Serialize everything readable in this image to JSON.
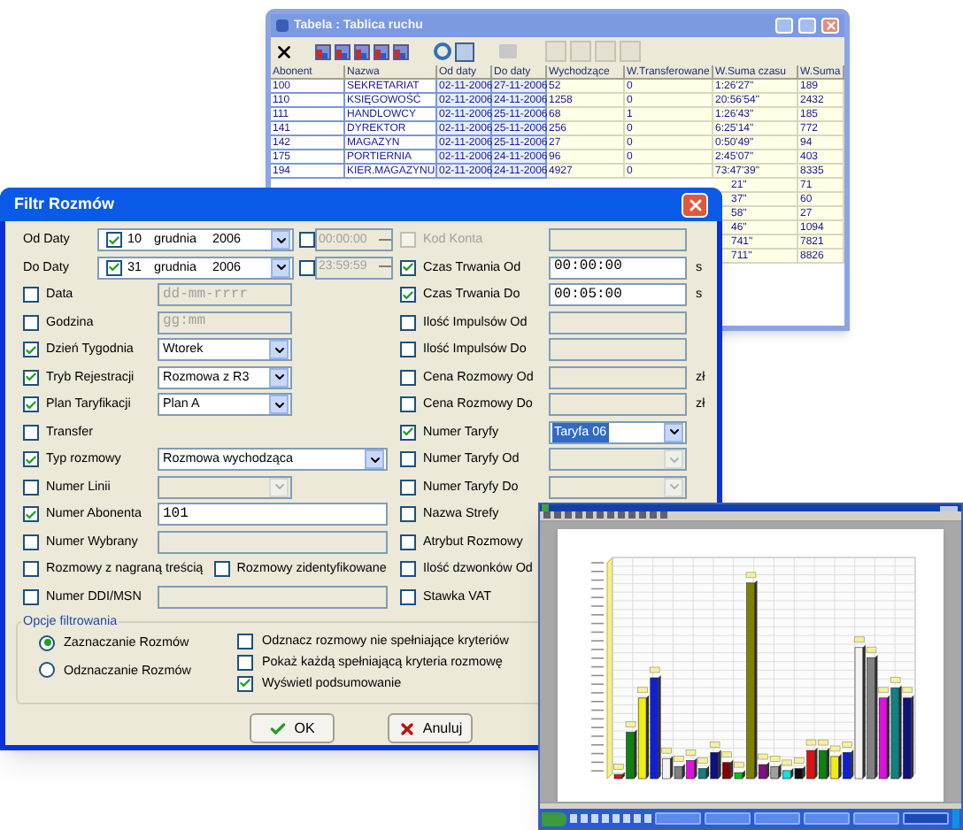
{
  "table_window": {
    "title": "Tabela : Tablica ruchu",
    "columns": [
      "Abonent",
      "Nazwa",
      "Od daty",
      "Do daty",
      "Wychodzące",
      "W.Transferowane",
      "W.Suma czasu",
      "W.Suma"
    ],
    "rows": [
      {
        "cells": [
          "100",
          "SEKRETARIAT",
          "02-11-2006",
          "27-11-2006",
          "52",
          "0",
          "1:26'27\"",
          "189"
        ]
      },
      {
        "cells": [
          "110",
          "KSIĘGOWOŚĆ",
          "02-11-2006",
          "24-11-2006",
          "1258",
          "0",
          "20:56'54\"",
          "2432"
        ]
      },
      {
        "cells": [
          "111",
          "HANDLOWCY",
          "02-11-2006",
          "25-11-2006",
          "68",
          "1",
          "1:26'43\"",
          "185"
        ]
      },
      {
        "cells": [
          "141",
          "DYREKTOR",
          "02-11-2006",
          "25-11-2006",
          "256",
          "0",
          "6:25'14\"",
          "772"
        ]
      },
      {
        "cells": [
          "142",
          "MAGAZYN",
          "02-11-2006",
          "25-11-2006",
          "27",
          "0",
          "0:50'49\"",
          "94"
        ]
      },
      {
        "cells": [
          "175",
          "PORTIERNIA",
          "02-11-2006",
          "24-11-2006",
          "96",
          "0",
          "2:45'07\"",
          "403"
        ]
      },
      {
        "cells": [
          "194",
          "KIER.MAGAZYNU",
          "02-11-2006",
          "24-11-2006",
          "4927",
          "0",
          "73:47'39\"",
          "8335"
        ]
      }
    ],
    "partial_rows": [
      {
        "w_suma_czasu": "21\"",
        "w_suma": "71"
      },
      {
        "w_suma_czasu": "37\"",
        "w_suma": "60"
      },
      {
        "w_suma_czasu": "58\"",
        "w_suma": "27"
      },
      {
        "w_suma_czasu": "46\"",
        "w_suma": "1094"
      },
      {
        "w_suma_czasu": "741\"",
        "w_suma": "7821"
      },
      {
        "w_suma_czasu": "711\"",
        "w_suma": "8826"
      }
    ]
  },
  "filter_dialog": {
    "title": "Filtr Rozmów",
    "date_rows": [
      {
        "label": "Od Daty",
        "checked": true,
        "day": "10",
        "month": "grudnia",
        "year": "2006",
        "time_checked": false,
        "time": "00:00:00"
      },
      {
        "label": "Do Daty",
        "checked": true,
        "day": "31",
        "month": "grudnia",
        "year": "2006",
        "time_checked": false,
        "time": "23:59:59"
      }
    ],
    "left_rows": [
      {
        "kind": "field",
        "label": "Data",
        "checked": false,
        "placeholder": "dd-mm-rrrr"
      },
      {
        "kind": "field",
        "label": "Godzina",
        "checked": false,
        "placeholder": "gg:mm"
      },
      {
        "kind": "select",
        "label": "Dzień Tygodnia",
        "checked": true,
        "value": "Wtorek"
      },
      {
        "kind": "select",
        "label": "Tryb Rejestracji",
        "checked": true,
        "value": "Rozmowa z R3"
      },
      {
        "kind": "select",
        "label": "Plan Taryfikacji",
        "checked": true,
        "value": "Plan A"
      },
      {
        "kind": "check",
        "label": "Transfer",
        "checked": false
      },
      {
        "kind": "wide_select",
        "label": "Typ rozmowy",
        "checked": true,
        "value": "Rozmowa wychodząca"
      },
      {
        "kind": "select",
        "label": "Numer Linii",
        "checked": false
      },
      {
        "kind": "wide_field",
        "label": "Numer Abonenta",
        "checked": true,
        "value": "101"
      },
      {
        "kind": "wide_field",
        "label": "Numer Wybrany",
        "checked": false
      },
      {
        "kind": "pair",
        "items": [
          {
            "label": "Rozmowy z nagraną treścią",
            "checked": false
          },
          {
            "label": "Rozmowy zidentyfikowane",
            "checked": false
          }
        ]
      },
      {
        "kind": "wide_field",
        "label": "Numer DDI/MSN",
        "checked": false
      }
    ],
    "right_rows": [
      {
        "kind": "field",
        "label": "Kod Konta",
        "checked": false,
        "disabled": true
      },
      {
        "kind": "field",
        "label": "Czas Trwania Od",
        "checked": true,
        "disabled": false,
        "value": "00:00:00",
        "unit": "s"
      },
      {
        "kind": "field",
        "label": "Czas Trwania Do",
        "checked": true,
        "disabled": false,
        "value": "00:05:00",
        "unit": "s"
      },
      {
        "kind": "field",
        "label": "Ilość Impulsów Od",
        "checked": false,
        "disabled": false
      },
      {
        "kind": "field",
        "label": "Ilość Impulsów Do",
        "checked": false,
        "disabled": false
      },
      {
        "kind": "field",
        "label": "Cena Rozmowy Od",
        "checked": false,
        "disabled": false,
        "unit": "zł"
      },
      {
        "kind": "field",
        "label": "Cena Rozmowy Do",
        "checked": false,
        "disabled": false,
        "unit": "zł"
      },
      {
        "kind": "select",
        "label": "Numer Taryfy",
        "checked": true,
        "disabled": false,
        "value": "Taryfa 06",
        "focused": true
      },
      {
        "kind": "select",
        "label": "Numer Taryfy Od",
        "checked": false,
        "disabled": false,
        "focused": false
      },
      {
        "kind": "select",
        "label": "Numer Taryfy Do",
        "checked": false,
        "disabled": false,
        "focused": false
      },
      {
        "kind": "check",
        "label": "Nazwa Strefy",
        "checked": false,
        "disabled": false
      },
      {
        "kind": "check",
        "label": "Atrybut Rozmowy",
        "checked": false,
        "disabled": false
      },
      {
        "kind": "check",
        "label": "Ilość dzwonków Od",
        "checked": false,
        "disabled": false
      },
      {
        "kind": "check",
        "label": "Stawka VAT",
        "checked": false,
        "disabled": false
      }
    ],
    "options_group": {
      "title": "Opcje filtrowania",
      "radios": [
        {
          "label": "Zaznaczanie Rozmów",
          "selected": true
        },
        {
          "label": "Odznaczanie Rozmów",
          "selected": false
        }
      ],
      "checkboxes": [
        {
          "label": "Odznacz rozmowy nie spełniające kryteriów",
          "checked": false
        },
        {
          "label": "Pokaż każdą spełniającą kryteria rozmowę",
          "checked": false
        },
        {
          "label": "Wyświetl podsumowanie",
          "checked": true
        }
      ]
    },
    "buttons": [
      {
        "kind": "ok",
        "label": "OK"
      },
      {
        "kind": "cancel",
        "label": "Anuluj"
      }
    ]
  }
}
